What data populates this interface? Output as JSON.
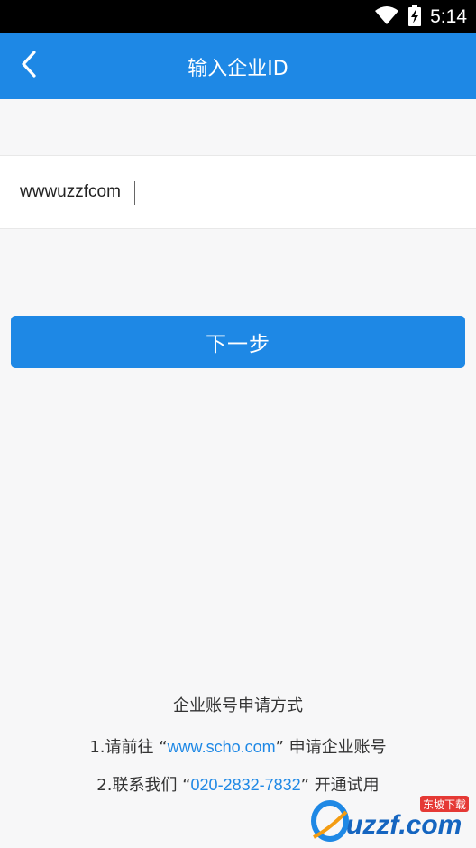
{
  "status_bar": {
    "time": "5:14"
  },
  "app_bar": {
    "title": "输入企业ID"
  },
  "form": {
    "company_id_value": "wwwuzzfcom"
  },
  "next_button": {
    "label": "下一步"
  },
  "info": {
    "title": "企业账号申请方式",
    "line1_prefix": "1.请前往 “",
    "line1_link": "www.scho.com",
    "line1_suffix": "” 申请企业账号",
    "line2_prefix": "2.联系我们 “",
    "line2_phone": "020-2832-7832",
    "line2_suffix": "” 开通试用"
  },
  "watermark": {
    "text": "uzzf.com",
    "badge": "东坡下载"
  },
  "colors": {
    "primary": "#1e88e5",
    "background": "#f7f7f8",
    "status_bar": "#000000"
  }
}
